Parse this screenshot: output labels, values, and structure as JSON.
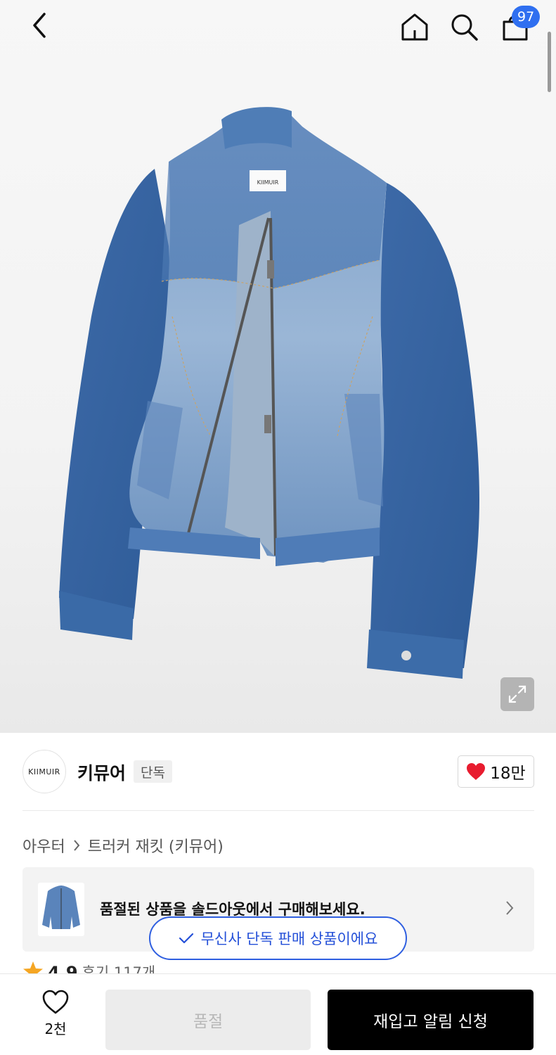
{
  "header": {
    "cart_count": "97"
  },
  "product_image": {
    "label_text": "KIIMUIR"
  },
  "brand": {
    "logo_text": "KIIMUIR",
    "name": "키뮤어",
    "tag": "단독",
    "likes": "18만"
  },
  "breadcrumb": {
    "category": "아우터",
    "product": "트러커 재킷 (키뮤어)"
  },
  "soldout_banner": {
    "text": "품절된 상품을 솔드아웃에서 구매해보세요."
  },
  "exclusive_toast": {
    "text": "무신사 단독 판매 상품이에요"
  },
  "rating": {
    "score": "4.9",
    "reviews": "후기 117개"
  },
  "bottom_bar": {
    "wish_count": "2천",
    "soldout_label": "품절",
    "restock_label": "재입고 알림 신청"
  },
  "colors": {
    "accent_blue": "#2f6ff0",
    "heart_red": "#e81c2f",
    "star_orange": "#f5a623"
  }
}
